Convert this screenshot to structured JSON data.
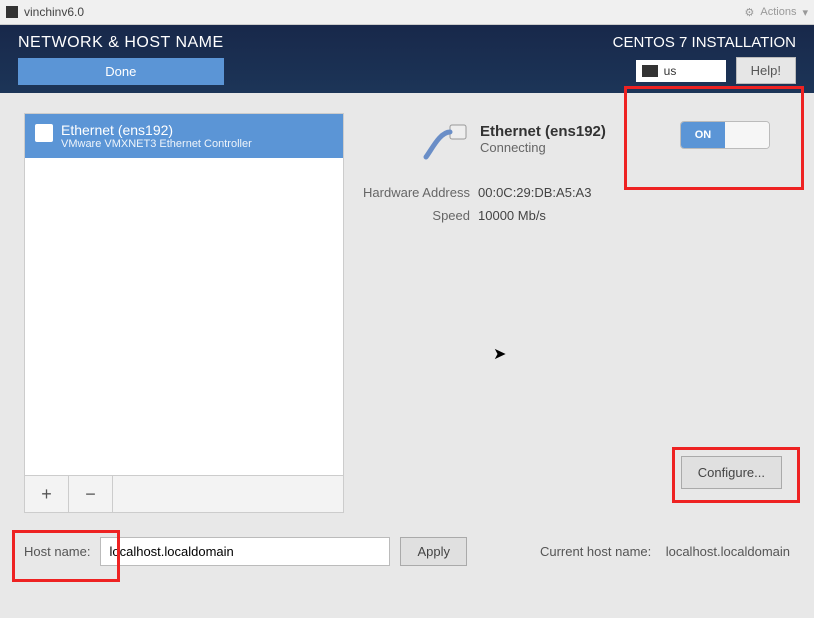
{
  "window": {
    "title": "vinchinv6.0",
    "actions_label": "Actions"
  },
  "header": {
    "page_title": "NETWORK & HOST NAME",
    "done_label": "Done",
    "install_title": "CENTOS 7 INSTALLATION",
    "keyboard_layout": "us",
    "help_label": "Help!"
  },
  "devices": [
    {
      "name": "Ethernet (ens192)",
      "sub": "VMware VMXNET3 Ethernet Controller"
    }
  ],
  "toolbar": {
    "add_label": "+",
    "remove_label": "−"
  },
  "connection": {
    "name": "Ethernet (ens192)",
    "status": "Connecting",
    "toggle_label": "ON",
    "details": [
      {
        "label": "Hardware Address",
        "value": "00:0C:29:DB:A5:A3"
      },
      {
        "label": "Speed",
        "value": "10000 Mb/s"
      }
    ],
    "configure_label": "Configure..."
  },
  "hostname": {
    "label": "Host name:",
    "value": "localhost.localdomain",
    "apply_label": "Apply",
    "current_label": "Current host name:",
    "current_value": "localhost.localdomain"
  }
}
